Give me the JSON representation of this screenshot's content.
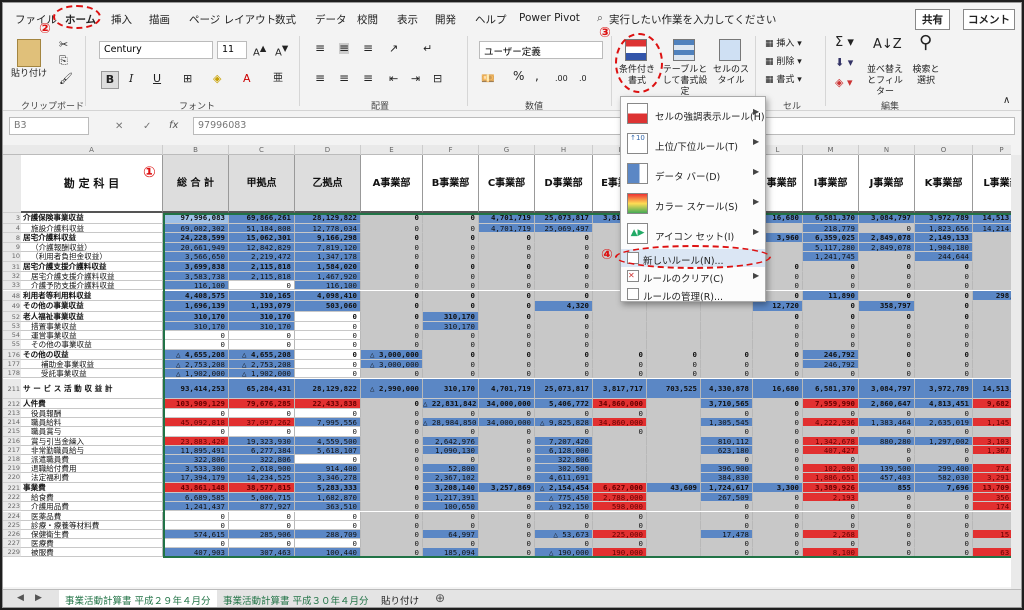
{
  "menu": {
    "tabs": [
      "ファイル",
      "ホーム",
      "挿入",
      "描画",
      "ページ レイアウト",
      "数式",
      "データ",
      "校閲",
      "表示",
      "開発",
      "ヘルプ",
      "Power Pivot"
    ],
    "search": "実行したい作業を入力してください",
    "share": "共有",
    "comment": "コメント"
  },
  "ribbon": {
    "clipboard": {
      "paste": "貼り付け",
      "label": "クリップボード"
    },
    "font": {
      "name": "Century",
      "size": "11",
      "label": "フォント"
    },
    "align": {
      "label": "配置"
    },
    "number": {
      "format": "ユーザー定義",
      "label": "数値"
    },
    "styles": {
      "cond": "条件付き書式",
      "table": "テーブルとして書式設定",
      "cell": "セルのスタイル"
    },
    "cells": {
      "insert": "挿入",
      "delete": "削除",
      "format": "書式",
      "label": "セル"
    },
    "edit": {
      "sort": "並べ替えとフィルター",
      "find": "検索と選択",
      "label": "編集"
    }
  },
  "formula": {
    "ref": "B3",
    "fx": "fx",
    "value": "97996083"
  },
  "columns": [
    "A",
    "B",
    "C",
    "D",
    "E",
    "F",
    "G",
    "H",
    "I",
    "J",
    "K",
    "L",
    "M",
    "N",
    "O",
    "P"
  ],
  "headers": [
    "勘 定 科 目",
    "総 合 計",
    "甲拠点",
    "乙拠点",
    "A事業部",
    "B事業部",
    "C事業部",
    "D事業部",
    "E事業部",
    "",
    "F事業部",
    "H事業部",
    "I事業部",
    "J事業部",
    "K事業部",
    "L事業部"
  ],
  "rows": [
    {
      "n": "3",
      "l": "介護保険事業収益",
      "b": true,
      "v": [
        "97,996,083",
        "69,866,261",
        "28,129,822",
        "0",
        "0",
        "4,701,719",
        "25,073,817",
        "3,817,717",
        "",
        "",
        "16,680",
        "6,581,370",
        "3,084,797",
        "3,972,789",
        "14,513,028"
      ]
    },
    {
      "n": "4",
      "l": "施設介護料収益",
      "i": 1,
      "v": [
        "69,002,302",
        "51,184,808",
        "12,778,034",
        "0",
        "0",
        "4,701,719",
        "25,069,497",
        "",
        "",
        "",
        "",
        "218,779",
        "0",
        "1,823,656",
        "14,214,452"
      ]
    },
    {
      "n": "8",
      "l": "居宅介護料収益",
      "b": true,
      "v": [
        "24,228,599",
        "15,062,301",
        "9,166,298",
        "0",
        "0",
        "0",
        "0",
        "",
        "",
        "",
        "3,960",
        "6,359,025",
        "2,849,078",
        "2,149,133",
        "0"
      ]
    },
    {
      "n": "9",
      "l": "（介護報酬収益）",
      "i": 1,
      "v": [
        "20,661,949",
        "12,842,829",
        "7,819,120",
        "0",
        "0",
        "0",
        "0",
        "",
        "",
        "",
        "",
        "5,117,280",
        "2,849,078",
        "1,904,180",
        "0"
      ]
    },
    {
      "n": "10",
      "l": "（利用者負担金収益）",
      "i": 1,
      "v": [
        "3,566,650",
        "2,219,472",
        "1,347,178",
        "0",
        "0",
        "0",
        "0",
        "",
        "",
        "",
        "",
        "1,241,745",
        "0",
        "244,644",
        "0"
      ]
    },
    {
      "n": "31",
      "l": "居宅介護支援介護料収益",
      "b": true,
      "v": [
        "3,699,838",
        "2,115,818",
        "1,584,020",
        "0",
        "0",
        "0",
        "0",
        "",
        "",
        "",
        "0",
        "0",
        "0",
        "0",
        "0"
      ]
    },
    {
      "n": "32",
      "l": "居宅介護支援介護料収益",
      "i": 1,
      "v": [
        "3,583,738",
        "2,115,818",
        "1,467,920",
        "0",
        "0",
        "0",
        "0",
        "",
        "",
        "",
        "0",
        "0",
        "0",
        "0",
        "0"
      ]
    },
    {
      "n": "33",
      "l": "介護予防支援介護料収益",
      "i": 1,
      "v": [
        "116,100",
        "0",
        "116,100",
        "0",
        "0",
        "0",
        "0",
        "",
        "",
        "",
        "0",
        "0",
        "0",
        "0",
        "0"
      ]
    },
    {
      "n": "48",
      "l": "利用者等利用料収益",
      "b": true,
      "v": [
        "4,408,575",
        "310,165",
        "4,098,410",
        "0",
        "0",
        "0",
        "0",
        "",
        "",
        "",
        "0",
        "11,890",
        "0",
        "0",
        "298,576"
      ]
    },
    {
      "n": "49",
      "l": "その他の事業収益",
      "b": true,
      "v": [
        "1,696,139",
        "1,193,079",
        "503,060",
        "0",
        "0",
        "0",
        "4,320",
        "",
        "",
        "",
        "12,720",
        "0",
        "358,797",
        "0",
        "0"
      ]
    },
    {
      "n": "52",
      "l": "老人福祉事業収益",
      "b": true,
      "v": [
        "310,170",
        "310,170",
        "0",
        "0",
        "310,170",
        "0",
        "0",
        "",
        "",
        "",
        "0",
        "0",
        "0",
        "0",
        "0"
      ]
    },
    {
      "n": "53",
      "l": "措置事業収益",
      "i": 1,
      "v": [
        "310,170",
        "310,170",
        "0",
        "0",
        "310,170",
        "0",
        "0",
        "",
        "",
        "",
        "0",
        "0",
        "0",
        "0",
        "0"
      ]
    },
    {
      "n": "54",
      "l": "運営事業収益",
      "i": 1,
      "v": [
        "0",
        "0",
        "0",
        "0",
        "0",
        "0",
        "0",
        "",
        "",
        "",
        "0",
        "0",
        "0",
        "0",
        "0"
      ]
    },
    {
      "n": "55",
      "l": "その他の事業収益",
      "i": 1,
      "v": [
        "0",
        "0",
        "0",
        "0",
        "0",
        "0",
        "0",
        "",
        "",
        "",
        "0",
        "0",
        "0",
        "0",
        "0"
      ]
    },
    {
      "n": "176",
      "l": "その他の収益",
      "b": true,
      "v": [
        "△ 4,655,208",
        "△ 4,655,208",
        "0",
        "△ 3,000,000",
        "0",
        "0",
        "0",
        "0",
        "0",
        "0",
        "0",
        "246,792",
        "0",
        "0",
        "0"
      ]
    },
    {
      "n": "177",
      "l": "補助金事業収益",
      "i": 2,
      "v": [
        "△ 2,753,208",
        "△ 2,753,208",
        "0",
        "△ 3,000,000",
        "0",
        "0",
        "0",
        "0",
        "0",
        "0",
        "0",
        "246,792",
        "0",
        "0",
        "0"
      ]
    },
    {
      "n": "178",
      "l": "受託事業収益",
      "i": 2,
      "v": [
        "△ 1,902,000",
        "△ 1,902,000",
        "0",
        "0",
        "0",
        "0",
        "0",
        "0",
        "0",
        "0",
        "0",
        "0",
        "0",
        "0",
        "0"
      ]
    },
    {
      "n": "211",
      "l": "サ ー ビ ス 活 動 収 益 計",
      "b": true,
      "t": true,
      "v": [
        "93,414,253",
        "65,284,431",
        "28,129,822",
        "△ 2,990,000",
        "310,170",
        "4,701,719",
        "25,073,817",
        "3,817,717",
        "703,525",
        "4,330,878",
        "16,680",
        "6,581,370",
        "3,084,797",
        "3,972,789",
        "14,513,028"
      ]
    },
    {
      "n": "212",
      "l": "人件費",
      "b": true,
      "v": [
        "103,909,129",
        "79,676,285",
        "22,433,838",
        "0",
        "△ 22,831,842",
        "34,000,000",
        "5,406,772",
        "34,860,000",
        "",
        "3,710,565",
        "0",
        "7,959,990",
        "2,860,647",
        "4,813,451",
        "9,682,329"
      ]
    },
    {
      "n": "213",
      "l": "役員報酬",
      "i": 1,
      "v": [
        "0",
        "0",
        "0",
        "0",
        "0",
        "0",
        "0",
        "0",
        "",
        "0",
        "0",
        "0",
        "0",
        "0",
        "0"
      ]
    },
    {
      "n": "214",
      "l": "職員給料",
      "i": 1,
      "v": [
        "45,092,818",
        "37,097,262",
        "7,995,556",
        "0",
        "△ 28,984,850",
        "34,000,000",
        "△ 9,825,828",
        "34,860,000",
        "",
        "1,305,545",
        "0",
        "4,222,936",
        "1,383,464",
        "2,635,019",
        "1,145,766"
      ]
    },
    {
      "n": "215",
      "l": "職員賞与",
      "i": 1,
      "v": [
        "0",
        "0",
        "0",
        "0",
        "0",
        "0",
        "0",
        "0",
        "",
        "0",
        "0",
        "0",
        "0",
        "0",
        "0"
      ]
    },
    {
      "n": "216",
      "l": "賞与引当金繰入",
      "i": 1,
      "v": [
        "23,883,420",
        "19,323,930",
        "4,559,500",
        "0",
        "2,642,976",
        "0",
        "7,207,420",
        "",
        "",
        "810,112",
        "0",
        "1,342,678",
        "880,280",
        "1,297,002",
        "3,103,448"
      ]
    },
    {
      "n": "217",
      "l": "非常勤職員給与",
      "i": 1,
      "v": [
        "11,895,491",
        "6,277,384",
        "5,618,107",
        "0",
        "1,090,130",
        "0",
        "6,128,000",
        "",
        "",
        "623,180",
        "0",
        "407,427",
        "0",
        "0",
        "1,367,171"
      ]
    },
    {
      "n": "218",
      "l": "派遣職員費",
      "i": 1,
      "v": [
        "322,806",
        "322,806",
        "0",
        "0",
        "0",
        "0",
        "322,806",
        "",
        "",
        "0",
        "0",
        "0",
        "0",
        "0",
        "0"
      ]
    },
    {
      "n": "219",
      "l": "退職給付費用",
      "i": 1,
      "v": [
        "3,533,300",
        "2,618,900",
        "914,400",
        "0",
        "52,800",
        "0",
        "302,500",
        "",
        "",
        "396,900",
        "0",
        "102,900",
        "139,500",
        "299,400",
        "774,900"
      ]
    },
    {
      "n": "220",
      "l": "法定福利費",
      "i": 1,
      "v": [
        "17,394,179",
        "14,234,525",
        "3,346,278",
        "0",
        "2,367,102",
        "0",
        "4,611,691",
        "",
        "",
        "384,830",
        "0",
        "1,886,651",
        "457,403",
        "582,030",
        "3,291,080"
      ]
    },
    {
      "n": "221",
      "l": "事業費",
      "b": true,
      "v": [
        "43,861,148",
        "38,577,815",
        "5,283,333",
        "0",
        "3,208,140",
        "3,257,869",
        "△ 2,154,454",
        "6,627,000",
        "43,609",
        "1,724,617",
        "3,300",
        "3,389,926",
        "855",
        "7,696",
        "13,709,210"
      ]
    },
    {
      "n": "222",
      "l": "給食費",
      "i": 1,
      "v": [
        "6,689,585",
        "5,006,715",
        "1,682,870",
        "0",
        "1,217,391",
        "0",
        "△ 775,450",
        "2,788,000",
        "",
        "267,509",
        "0",
        "2,193",
        "0",
        "0",
        "356,800"
      ]
    },
    {
      "n": "223",
      "l": "介護用品費",
      "i": 1,
      "v": [
        "1,241,437",
        "877,927",
        "363,510",
        "0",
        "100,650",
        "0",
        "△ 192,150",
        "598,000",
        "",
        "0",
        "0",
        "0",
        "0",
        "0",
        "174,426"
      ]
    },
    {
      "n": "224",
      "l": "医薬品費",
      "i": 1,
      "v": [
        "0",
        "0",
        "0",
        "0",
        "0",
        "0",
        "0",
        "0",
        "",
        "0",
        "0",
        "0",
        "0",
        "0",
        "0"
      ]
    },
    {
      "n": "225",
      "l": "診療・療養等材料費",
      "i": 1,
      "v": [
        "0",
        "0",
        "0",
        "0",
        "0",
        "0",
        "0",
        "0",
        "",
        "0",
        "0",
        "0",
        "0",
        "0",
        "0"
      ]
    },
    {
      "n": "226",
      "l": "保健衛生費",
      "i": 1,
      "v": [
        "574,615",
        "285,906",
        "288,709",
        "0",
        "64,997",
        "0",
        "△ 53,673",
        "225,000",
        "",
        "17,478",
        "0",
        "2,268",
        "0",
        "0",
        "15,113"
      ]
    },
    {
      "n": "227",
      "l": "医療費",
      "i": 1,
      "v": [
        "0",
        "0",
        "0",
        "0",
        "0",
        "0",
        "0",
        "0",
        "",
        "0",
        "0",
        "0",
        "0",
        "0",
        "0"
      ]
    },
    {
      "n": "229",
      "l": "被服費",
      "i": 1,
      "v": [
        "407,903",
        "307,463",
        "100,440",
        "0",
        "185,094",
        "0",
        "△ 190,000",
        "190,000",
        "",
        "0",
        "0",
        "8,100",
        "0",
        "0",
        "63,103"
      ]
    }
  ],
  "dropdown": {
    "items": [
      "セルの強調表示ルール(H)",
      "上位/下位ルール(T)",
      "データ バー(D)",
      "カラー スケール(S)",
      "アイコン セット(I)",
      "新しいルール(N)...",
      "ルールのクリア(C)",
      "ルールの管理(R)..."
    ]
  },
  "sheets": [
    "事業活動計算書 平成２９年４月分",
    "事業活動計算書 平成３０年４月分",
    "貼り付け"
  ],
  "annotations": [
    "①",
    "②",
    "③",
    "④"
  ],
  "colors": {
    "red": "#e23030",
    "blue": "#5b87c5",
    "grey": "#c8c8c8",
    "lightblue": "#9ec0e6"
  }
}
